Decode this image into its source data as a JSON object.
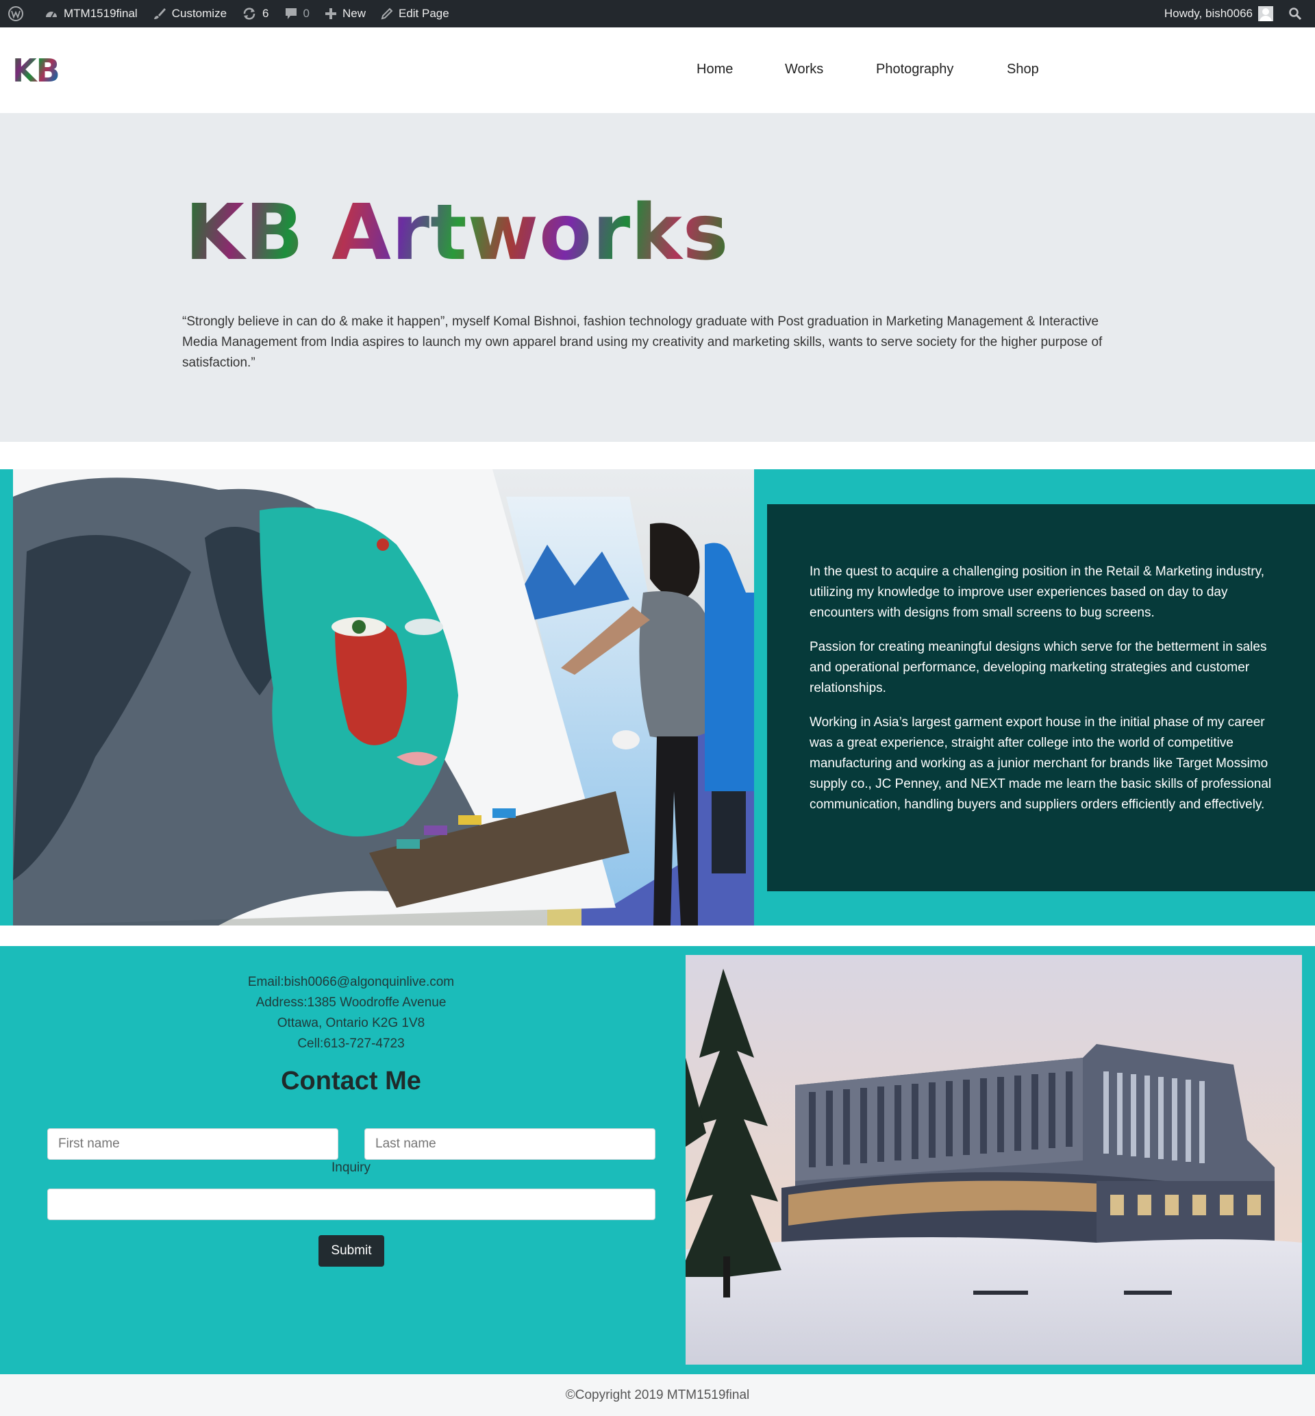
{
  "admin_bar": {
    "site_name": "MTM1519final",
    "customize": "Customize",
    "updates_count": "6",
    "comments_count": "0",
    "new": "New",
    "edit_page": "Edit Page",
    "howdy": "Howdy, bish0066"
  },
  "header": {
    "logo": "KB",
    "nav": [
      "Home",
      "Works",
      "Photography",
      "Shop"
    ]
  },
  "hero": {
    "title": "KB Artworks",
    "quote": "“Strongly believe in can do & make it happen”, myself Komal Bishnoi, fashion technology graduate with Post graduation in Marketing Management & Interactive Media Management from India aspires to launch my own apparel brand using my creativity and marketing skills, wants to serve society  for the higher purpose of satisfaction.”"
  },
  "about": {
    "paragraphs": [
      "In the quest to acquire a challenging position in the Retail & Marketing industry, utilizing my knowledge to improve user experiences based on day to day encounters with designs from small screens to bug screens.",
      "Passion for creating meaningful designs which serve for the betterment in sales and operational performance, developing marketing strategies and customer relationships.",
      "Working in Asia’s largest garment export house in the initial phase of my career was a great experience, straight after college into the world of competitive manufacturing and working as a junior merchant for brands like Target Mossimo supply co., JC Penney, and NEXT made me learn the basic skills of professional communication, handling buyers and suppliers orders efficiently and effectively."
    ]
  },
  "contact": {
    "email": "Email:bish0066@algonquinlive.com",
    "address": "Address:1385 Woodroffe Avenue",
    "city": "Ottawa, Ontario K2G 1V8",
    "cell": "Cell:613-727-4723",
    "title": "Contact Me",
    "first_name_placeholder": "First name",
    "last_name_placeholder": "Last name",
    "inquiry_label": "Inquiry",
    "inquiry_value": "",
    "submit": "Submit"
  },
  "footer": {
    "copyright": "©Copyright 2019 MTM1519final"
  },
  "colors": {
    "admin_bar": "#23282d",
    "hero_bg": "#e8ebee",
    "teal": "#1bbcba",
    "dark_teal": "#063a3a",
    "submit_bg": "#222b30"
  }
}
